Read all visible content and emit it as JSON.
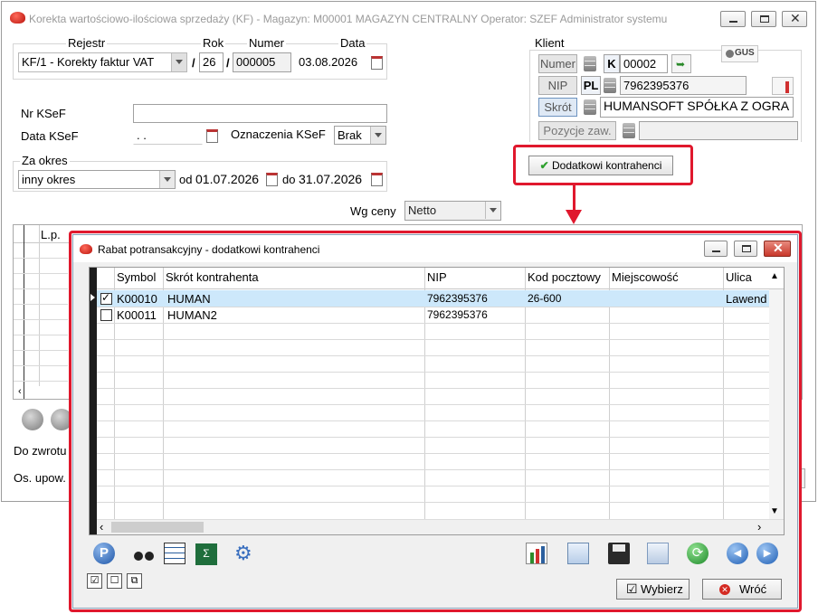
{
  "main_window": {
    "title": "Korekta wartościowo-ilościowa sprzedaży (KF) - Magazyn: M00001 MAGAZYN CENTRALNY  Operator: SZEF Administrator systemu",
    "header": {
      "rejestr_label": "Rejestr",
      "rok_label": "Rok",
      "numer_label": "Numer",
      "data_label": "Data",
      "rejestr_value": "KF/1   - Korekty faktur VAT",
      "slash1": "/",
      "rok_value": "26",
      "slash2": "/",
      "numer_value": "000005",
      "data_value": "03.08.2026"
    },
    "ksef": {
      "nr_label": "Nr KSeF",
      "nr_value": "",
      "data_label": "Data KSeF",
      "data_value": "  .  .",
      "oznaczenia_label": "Oznaczenia KSeF",
      "oznaczenia_value": "Brak"
    },
    "okres": {
      "label": "Za okres",
      "value": "inny okres",
      "od_label": "od",
      "od_value": "01.07.2026",
      "do_label": "do",
      "do_value": "31.07.2026"
    },
    "ceny": {
      "label": "Wg ceny",
      "value": "Netto"
    },
    "klient": {
      "label": "Klient",
      "gus_label": "GUS",
      "numer_btn": "Numer",
      "numer_prefix": "K",
      "numer_value": "00002",
      "nip_btn": "NIP",
      "nip_prefix": "PL",
      "nip_value": "7962395376",
      "skrot_btn": "Skrót",
      "skrot_value": "HUMANSOFT SPÓŁKA Z OGRA",
      "pozycje_btn": "Pozycje zaw.",
      "pozycje_value": ""
    },
    "dodatkowi_button": "Dodatkowi kontrahenci",
    "table": {
      "lp_label": "L.p."
    },
    "bottom": {
      "do_zwrotu_label": "Do zwrotu",
      "os_upow_label": "Os. upow."
    }
  },
  "dialog": {
    "title": "Rabat potransakcyjny - dodatkowi kontrahenci",
    "columns": [
      "Symbol",
      "Skrót kontrahenta",
      "NIP",
      "Kod pocztowy",
      "Miejscowość",
      "Ulica"
    ],
    "rows": [
      {
        "checked": true,
        "symbol": "K00010",
        "skrot": "HUMAN",
        "nip": "7962395376",
        "kod": "26-600",
        "miejscowosc": "",
        "ulica": "Lawend"
      },
      {
        "checked": false,
        "symbol": "K00011",
        "skrot": "HUMAN2",
        "nip": "7962395376",
        "kod": "",
        "miejscowosc": "",
        "ulica": ""
      }
    ],
    "wybierz_button": "Wybierz",
    "wroc_button": "Wróć"
  },
  "colors": {
    "highlight_border": "#e0182d",
    "selected_row": "#cde8fb",
    "dialog_title_bg": "#ffffff"
  }
}
